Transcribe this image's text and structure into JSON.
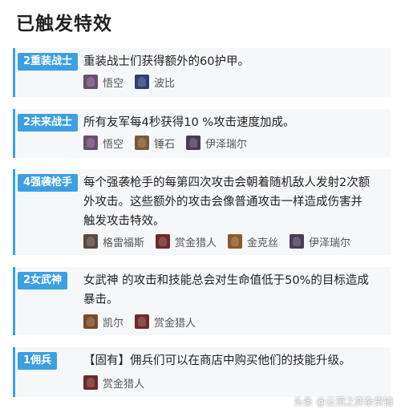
{
  "page": {
    "title": "已触发特效"
  },
  "traits": [
    {
      "badge": "2重装战士",
      "description": "重装战士们获得额外的60护甲。",
      "champions": [
        {
          "name": "悟空",
          "color": "#6b4d72"
        },
        {
          "name": "波比",
          "color": "#2f3f73"
        }
      ]
    },
    {
      "badge": "2未来战士",
      "description": "所有友军每4秒获得10 %攻击速度加成。",
      "champions": [
        {
          "name": "悟空",
          "color": "#6b4d72"
        },
        {
          "name": "锤石",
          "color": "#7a5a3a"
        },
        {
          "name": "伊泽瑞尔",
          "color": "#4b3b57"
        }
      ]
    },
    {
      "badge": "4强袭枪手",
      "description": "每个强袭枪手的每第四次攻击会朝着随机敌人发射2次额\n外攻击。这些额外的攻击会像普通攻击一样造成伤害并\n触发攻击特效。",
      "champions": [
        {
          "name": "格雷福斯",
          "color": "#5a4a3f"
        },
        {
          "name": "赏金猎人",
          "color": "#6e2a2a"
        },
        {
          "name": "金克丝",
          "color": "#8a5a2a"
        },
        {
          "name": "伊泽瑞尔",
          "color": "#4b3b57"
        }
      ]
    },
    {
      "badge": "2女武神",
      "description": "女武神 的攻击和技能总会对生命值低于50%的目标造成\n暴击。",
      "champions": [
        {
          "name": "凯尔",
          "color": "#7a4a2e"
        },
        {
          "name": "赏金猎人",
          "color": "#6e2a2a"
        }
      ]
    },
    {
      "badge": "1佣兵",
      "description": "【固有】佣兵们可以在商店中购买他们的技能升级。",
      "champions": [
        {
          "name": "赏金猎人",
          "color": "#6e2a2a"
        }
      ]
    }
  ],
  "watermark": "头条 @云顶之弈杂货铺"
}
